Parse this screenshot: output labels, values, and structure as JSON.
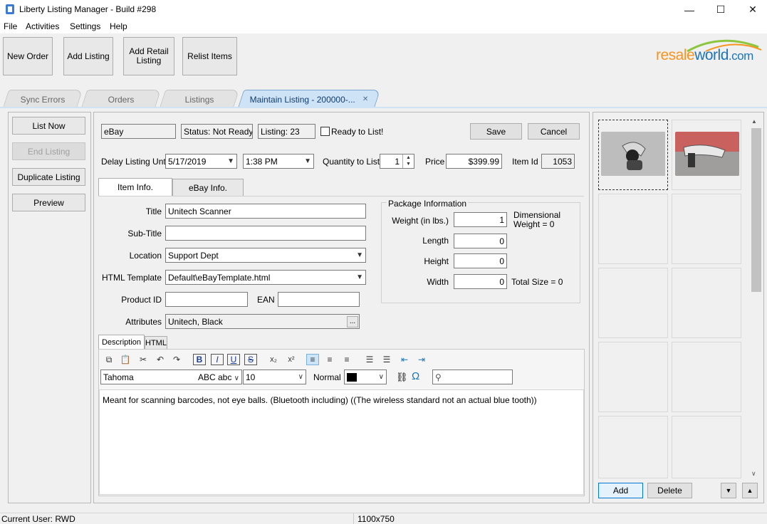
{
  "window": {
    "title": "Liberty Listing Manager - Build #298",
    "minimize": "—",
    "maximize": "☐",
    "close": "✕"
  },
  "menu": [
    "File",
    "Activities",
    "Settings",
    "Help"
  ],
  "toolbar": {
    "new_order": "New Order",
    "add_listing": "Add Listing",
    "add_retail_1": "Add Retail",
    "add_retail_2": "Listing",
    "relist": "Relist Items"
  },
  "logo": {
    "resale": "resale",
    "world": "world",
    "com": ".com"
  },
  "tabs": [
    {
      "label": "Sync Errors",
      "active": false
    },
    {
      "label": "Orders",
      "active": false
    },
    {
      "label": "Listings",
      "active": false
    },
    {
      "label": "Maintain Listing - 200000-...",
      "active": true,
      "close": "✕"
    }
  ],
  "left_buttons": {
    "list_now": "List Now",
    "end_listing": "End Listing",
    "duplicate": "Duplicate Listing",
    "preview": "Preview"
  },
  "header": {
    "marketplace": "eBay",
    "status": "Status: Not Ready",
    "listing": "Listing: 23",
    "ready_label": "Ready to List!",
    "save": "Save",
    "cancel": "Cancel"
  },
  "row2": {
    "delay_label": "Delay Listing Until",
    "delay_date": "5/17/2019",
    "delay_time": "1:38 PM",
    "qty_label": "Quantity to List",
    "qty_value": "1",
    "price_label": "Price",
    "price_value": "$399.99",
    "itemid_label": "Item Id",
    "itemid_value": "1053"
  },
  "inner_tabs": {
    "item_info": "Item Info.",
    "ebay_info": "eBay Info."
  },
  "form": {
    "title_label": "Title",
    "title_value": "Unitech Scanner",
    "subtitle_label": "Sub-Title",
    "subtitle_value": "",
    "location_label": "Location",
    "location_value": "Support Dept",
    "html_label": "HTML Template",
    "html_value": "Default\\eBayTemplate.html",
    "productid_label": "Product ID",
    "productid_value": "",
    "ean_label": "EAN",
    "ean_value": "",
    "attributes_label": "Attributes",
    "attributes_value": "Unitech, Black",
    "attributes_btn": "..."
  },
  "package": {
    "legend": "Package Information",
    "weight_label": "Weight (in lbs.)",
    "weight_value": "1",
    "dim_weight_1": "Dimensional",
    "dim_weight_2": "Weight = 0",
    "length_label": "Length",
    "length_value": "0",
    "height_label": "Height",
    "height_value": "0",
    "width_label": "Width",
    "width_value": "0",
    "total_size": "Total Size = 0"
  },
  "desc_tabs": {
    "description": "Description",
    "html": "HTML"
  },
  "editor": {
    "font": "Tahoma",
    "font_preview": "ABC abc",
    "size": "10",
    "style": "Normal",
    "content": "Meant for scanning barcodes, not eye balls. (Bluetooth including) ((The wireless standard not an actual blue tooth))",
    "omega": "Ω"
  },
  "images": {
    "add": "Add",
    "delete": "Delete"
  },
  "status": {
    "user": "Current User: RWD",
    "size": "1100x750"
  }
}
